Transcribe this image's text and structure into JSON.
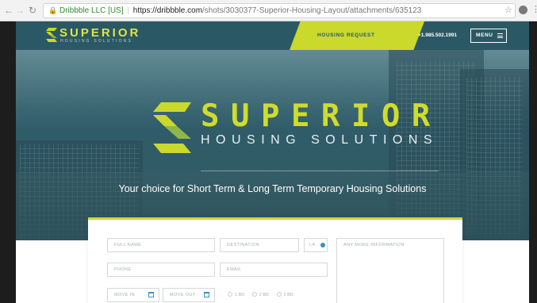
{
  "browser": {
    "secure_label": "Dribbble LLC [US]",
    "url_host": "https://dribbble.com",
    "url_path": "/shots/3030377-Superior-Housing-Layout/attachments/635123"
  },
  "navbar": {
    "logo_word": "SUPERIOR",
    "logo_sub": "HOUSING SOLUTIONS",
    "housing_request": "HOUSING REQUEST",
    "phone": "+1.985.502.1991",
    "menu_label": "MENU"
  },
  "hero": {
    "title": "SUPERIOR",
    "subtitle": "HOUSING SOLUTIONS",
    "tagline": "Your choice for Short Term & Long Term Temporary Housing Solutions"
  },
  "form": {
    "full_name_placeholder": "FULL NAME",
    "destination_placeholder": "DESTINATION",
    "state_value": "LA",
    "info_placeholder": "ANY MORE INFORMATION",
    "phone_placeholder": "PHONE",
    "email_placeholder": "EMAIL",
    "move_in_placeholder": "MOVE IN",
    "move_out_placeholder": "MOVE OUT",
    "bedroom_options": [
      "1 BD",
      "2 BD",
      "3 BD"
    ]
  },
  "colors": {
    "accent_yellow": "#cbd82c",
    "brand_teal": "#2b5865",
    "link_blue": "#3a90c8"
  }
}
